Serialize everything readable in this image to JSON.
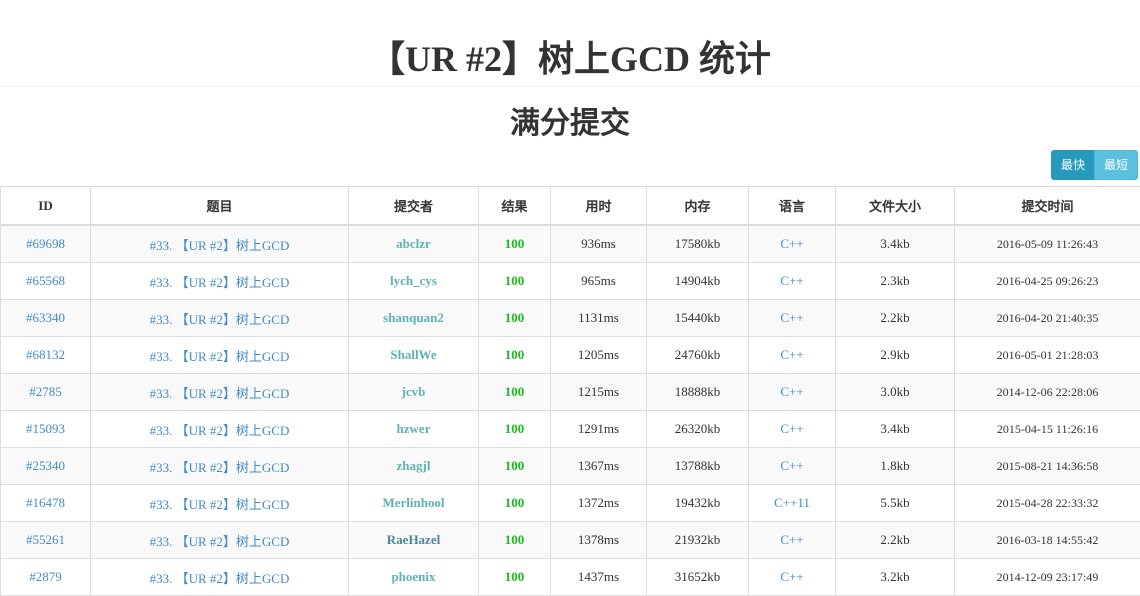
{
  "page_title": "【UR #2】树上GCD 统计",
  "section_title": "满分提交",
  "sort_buttons": {
    "fastest": "最快",
    "shortest": "最短"
  },
  "columns": [
    "ID",
    "题目",
    "提交者",
    "结果",
    "用时",
    "内存",
    "语言",
    "文件大小",
    "提交时间"
  ],
  "rows": [
    {
      "id": "#69698",
      "problem": "#33. 【UR #2】树上GCD",
      "submitter": "abclzr",
      "result": "100",
      "time": "936ms",
      "memory": "17580kb",
      "language": "C++",
      "size": "3.4kb",
      "submit_time": "2016-05-09 11:26:43"
    },
    {
      "id": "#65568",
      "problem": "#33. 【UR #2】树上GCD",
      "submitter": "lych_cys",
      "result": "100",
      "time": "965ms",
      "memory": "14904kb",
      "language": "C++",
      "size": "2.3kb",
      "submit_time": "2016-04-25 09:26:23"
    },
    {
      "id": "#63340",
      "problem": "#33. 【UR #2】树上GCD",
      "submitter": "shanquan2",
      "result": "100",
      "time": "1131ms",
      "memory": "15440kb",
      "language": "C++",
      "size": "2.2kb",
      "submit_time": "2016-04-20 21:40:35"
    },
    {
      "id": "#68132",
      "problem": "#33. 【UR #2】树上GCD",
      "submitter": "ShallWe",
      "result": "100",
      "time": "1205ms",
      "memory": "24760kb",
      "language": "C++",
      "size": "2.9kb",
      "submit_time": "2016-05-01 21:28:03"
    },
    {
      "id": "#2785",
      "problem": "#33. 【UR #2】树上GCD",
      "submitter": "jcvb",
      "result": "100",
      "time": "1215ms",
      "memory": "18888kb",
      "language": "C++",
      "size": "3.0kb",
      "submit_time": "2014-12-06 22:28:06"
    },
    {
      "id": "#15093",
      "problem": "#33. 【UR #2】树上GCD",
      "submitter": "hzwer",
      "result": "100",
      "time": "1291ms",
      "memory": "26320kb",
      "language": "C++",
      "size": "3.4kb",
      "submit_time": "2015-04-15 11:26:16"
    },
    {
      "id": "#25340",
      "problem": "#33. 【UR #2】树上GCD",
      "submitter": "zhagjl",
      "result": "100",
      "time": "1367ms",
      "memory": "13788kb",
      "language": "C++",
      "size": "1.8kb",
      "submit_time": "2015-08-21 14:36:58"
    },
    {
      "id": "#16478",
      "problem": "#33. 【UR #2】树上GCD",
      "submitter": "Merlinhool",
      "result": "100",
      "time": "1372ms",
      "memory": "19432kb",
      "language": "C++11",
      "size": "5.5kb",
      "submit_time": "2015-04-28 22:33:32"
    },
    {
      "id": "#55261",
      "problem": "#33. 【UR #2】树上GCD",
      "submitter": "RaeHazel",
      "result": "100",
      "time": "1378ms",
      "memory": "21932kb",
      "language": "C++",
      "size": "2.2kb",
      "submit_time": "2016-03-18 14:55:42"
    },
    {
      "id": "#2879",
      "problem": "#33. 【UR #2】树上GCD",
      "submitter": "phoenix",
      "result": "100",
      "time": "1437ms",
      "memory": "31652kb",
      "language": "C++",
      "size": "3.2kb",
      "submit_time": "2014-12-09 23:17:49"
    }
  ],
  "colors": {
    "link": "#428bca",
    "submitter": "#5eb3b2",
    "submitter_alt": "#4e8699",
    "score": "#1cba1c",
    "button_active": "#269abc",
    "button": "#5bc0de"
  }
}
